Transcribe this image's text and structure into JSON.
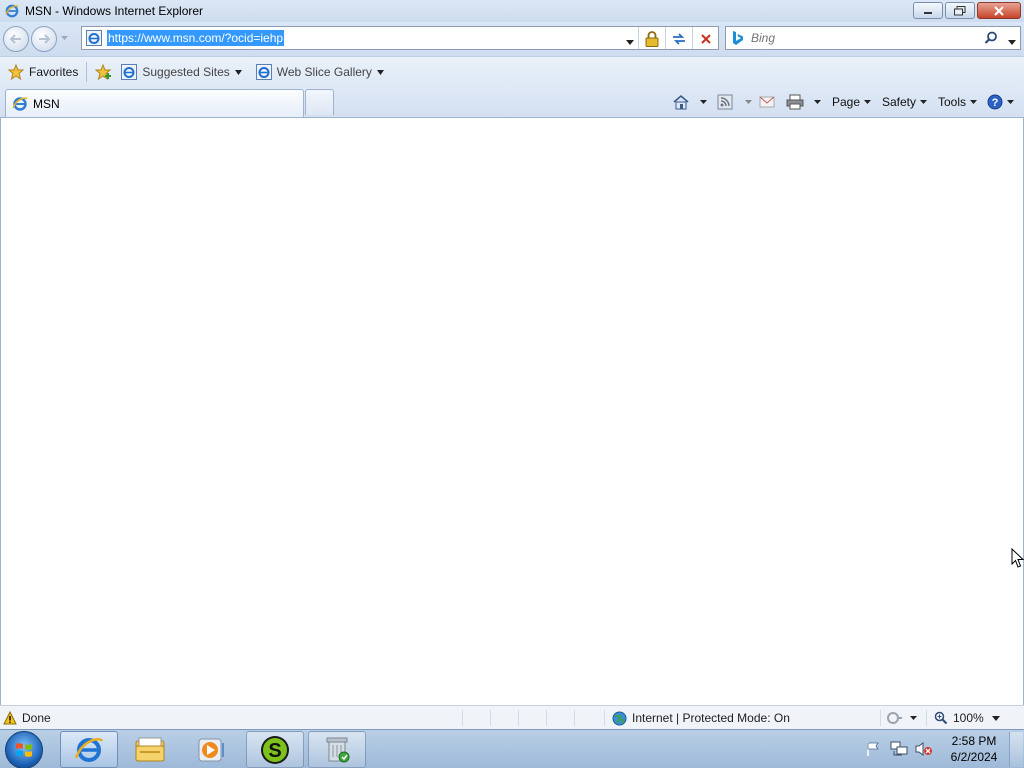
{
  "window": {
    "title": "MSN - Windows Internet Explorer",
    "minimize_icon": "minimize-icon",
    "maximize_icon": "restore-icon",
    "close_icon": "close-icon"
  },
  "navigation": {
    "back_icon": "back-arrow-icon",
    "forward_icon": "forward-arrow-icon",
    "address_url": "https://www.msn.com/?ocid=iehp",
    "lock_icon": "lock-icon",
    "refresh_icon": "refresh-icon",
    "stop_icon": "stop-icon"
  },
  "search": {
    "placeholder": "Bing",
    "provider_icon": "bing-icon",
    "search_icon": "magnifier-icon"
  },
  "favorites_bar": {
    "favorites_label": "Favorites",
    "items": [
      {
        "label": "Suggested Sites",
        "icon": "ie-page-icon"
      },
      {
        "label": "Web Slice Gallery",
        "icon": "ie-page-icon"
      }
    ]
  },
  "tabs": [
    {
      "label": "MSN",
      "icon": "ie-page-icon",
      "active": true
    }
  ],
  "command_bar": {
    "page_label": "Page",
    "safety_label": "Safety",
    "tools_label": "Tools",
    "icons": [
      "home-icon",
      "feeds-icon",
      "mail-icon",
      "print-icon",
      "help-icon"
    ]
  },
  "status_bar": {
    "status_text": "Done",
    "zone_text": "Internet | Protected Mode: On",
    "zoom_text": "100%"
  },
  "taskbar": {
    "pinned": [
      "internet-explorer-icon",
      "explorer-folder-icon",
      "media-player-icon",
      "s-app-icon",
      "recycle-app-icon"
    ],
    "clock_time": "2:58 PM",
    "clock_date": "6/2/2024"
  },
  "colors": {
    "chrome_blue": "#d9e6f5",
    "selection": "#3399ff",
    "taskbar": "#a9c2de"
  }
}
